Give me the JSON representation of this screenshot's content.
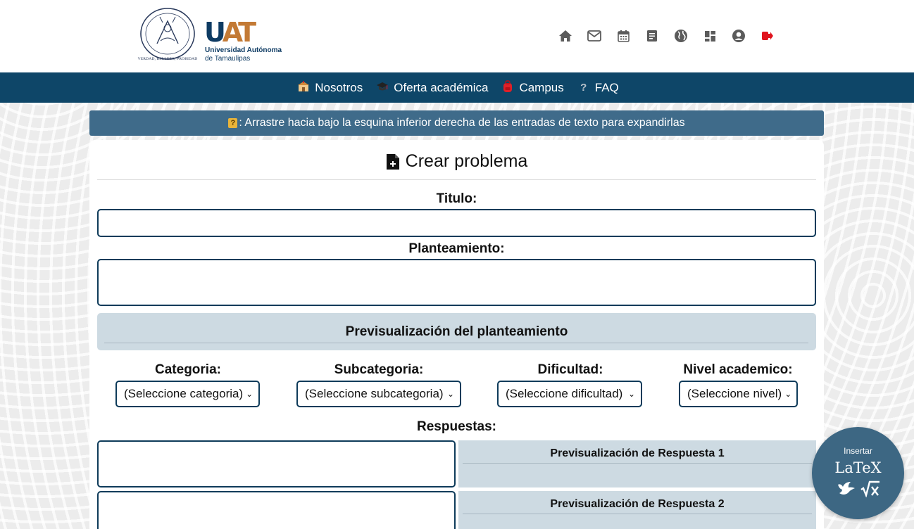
{
  "header": {
    "seal_motto": "VERDAD, BELLEZA, PROBIDAD",
    "logo_letters": {
      "u": "U",
      "at": "AT"
    },
    "university_line1": "Universidad Autónoma",
    "university_line2": "de Tamaulipas",
    "icons": [
      "home-icon",
      "mail-icon",
      "calendar-icon",
      "document-icon",
      "globe-icon",
      "dashboard-icon",
      "user-icon",
      "logout-icon"
    ],
    "colors": {
      "brand_blue": "#0e3b63",
      "brand_orange": "#c37a35",
      "logout_red": "#e0141e"
    }
  },
  "nav": {
    "items": [
      {
        "label": "Nosotros",
        "icon": "school-icon"
      },
      {
        "label": "Oferta académica",
        "icon": "graduation-cap-icon"
      },
      {
        "label": "Campus",
        "icon": "backpack-icon"
      },
      {
        "label": "FAQ",
        "icon": "question-icon"
      }
    ],
    "background": "#0e4668"
  },
  "info": {
    "badge": "?",
    "text": ": Arrastre hacia bajo la esquina inferior derecha de las entradas de texto para expandirlas"
  },
  "form": {
    "title": "Crear problema",
    "titulo_label": "Titulo:",
    "titulo_value": "",
    "planteamiento_label": "Planteamiento:",
    "planteamiento_value": "",
    "preview_title": "Previsualización del planteamiento",
    "selects": [
      {
        "label": "Categoria:",
        "value": "(Seleccione categoria)"
      },
      {
        "label": "Subcategoria:",
        "value": "(Seleccione subcategoria)"
      },
      {
        "label": "Dificultad:",
        "value": "(Seleccione dificultad)"
      },
      {
        "label": "Nivel academico:",
        "value": "(Seleccione nivel)"
      }
    ],
    "respuestas_label": "Respuestas:",
    "answers": [
      {
        "value": "",
        "preview_title": "Previsualización de Respuesta 1"
      },
      {
        "value": "",
        "preview_title": "Previsualización de Respuesta 2"
      }
    ]
  },
  "latex_button": {
    "label": "Insertar",
    "title": "LaTeX",
    "icons": [
      "bird-icon",
      "sqrt-x-icon"
    ]
  }
}
